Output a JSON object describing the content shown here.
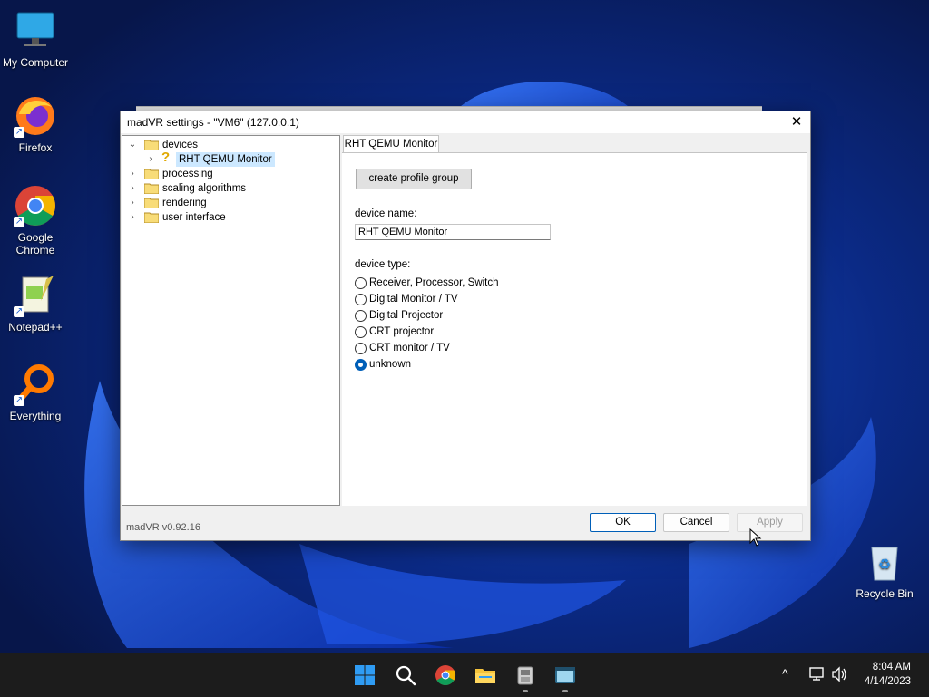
{
  "desktop": {
    "icons": [
      {
        "label": "My Computer",
        "icon": "monitor-icon"
      },
      {
        "label": "Firefox",
        "icon": "firefox-icon"
      },
      {
        "label": "Google Chrome",
        "icon": "chrome-icon"
      },
      {
        "label": "Notepad++",
        "icon": "notepadpp-icon"
      },
      {
        "label": "Everything",
        "icon": "everything-search-icon"
      },
      {
        "label": "Recycle Bin",
        "icon": "recycle-bin-icon"
      }
    ]
  },
  "window": {
    "title": "madVR settings - \"VM6\" (127.0.0.1)",
    "close_glyph": "✕",
    "tree": [
      {
        "label": "devices",
        "expanded": true,
        "expander": "⌄"
      },
      {
        "label": "RHT QEMU Monitor",
        "selected": true,
        "expander": "›",
        "icon": "question-mark-icon",
        "glyph": "?"
      },
      {
        "label": "processing",
        "expander": "›"
      },
      {
        "label": "scaling algorithms",
        "expander": "›"
      },
      {
        "label": "rendering",
        "expander": "›"
      },
      {
        "label": "user interface",
        "expander": "›"
      }
    ],
    "tab_label": "RHT QEMU Monitor",
    "create_profile_group": "create profile group",
    "device_name_label": "device name:",
    "device_name_value": "RHT QEMU Monitor",
    "device_type_label": "device type:",
    "device_types": [
      {
        "label": "Receiver, Processor, Switch",
        "checked": false
      },
      {
        "label": "Digital Monitor / TV",
        "checked": false
      },
      {
        "label": "Digital Projector",
        "checked": false
      },
      {
        "label": "CRT projector",
        "checked": false
      },
      {
        "label": "CRT monitor / TV",
        "checked": false
      },
      {
        "label": "unknown",
        "checked": true
      }
    ],
    "version": "madVR v0.92.16",
    "ok_label": "OK",
    "cancel_label": "Cancel",
    "apply_label": "Apply"
  },
  "taskbar": {
    "time": "8:04 AM",
    "date": "4/14/2023",
    "icons": [
      "start-icon",
      "search-icon",
      "chrome-icon",
      "file-explorer-icon",
      "madvr-settings-icon",
      "terminal-icon"
    ],
    "tray": {
      "chevron": "^",
      "network_icon": "network-icon",
      "volume_icon": "volume-icon"
    }
  },
  "colors": {
    "accent": "#005fb8",
    "selection": "#cce8ff",
    "taskbar": "#1c1c1c"
  }
}
